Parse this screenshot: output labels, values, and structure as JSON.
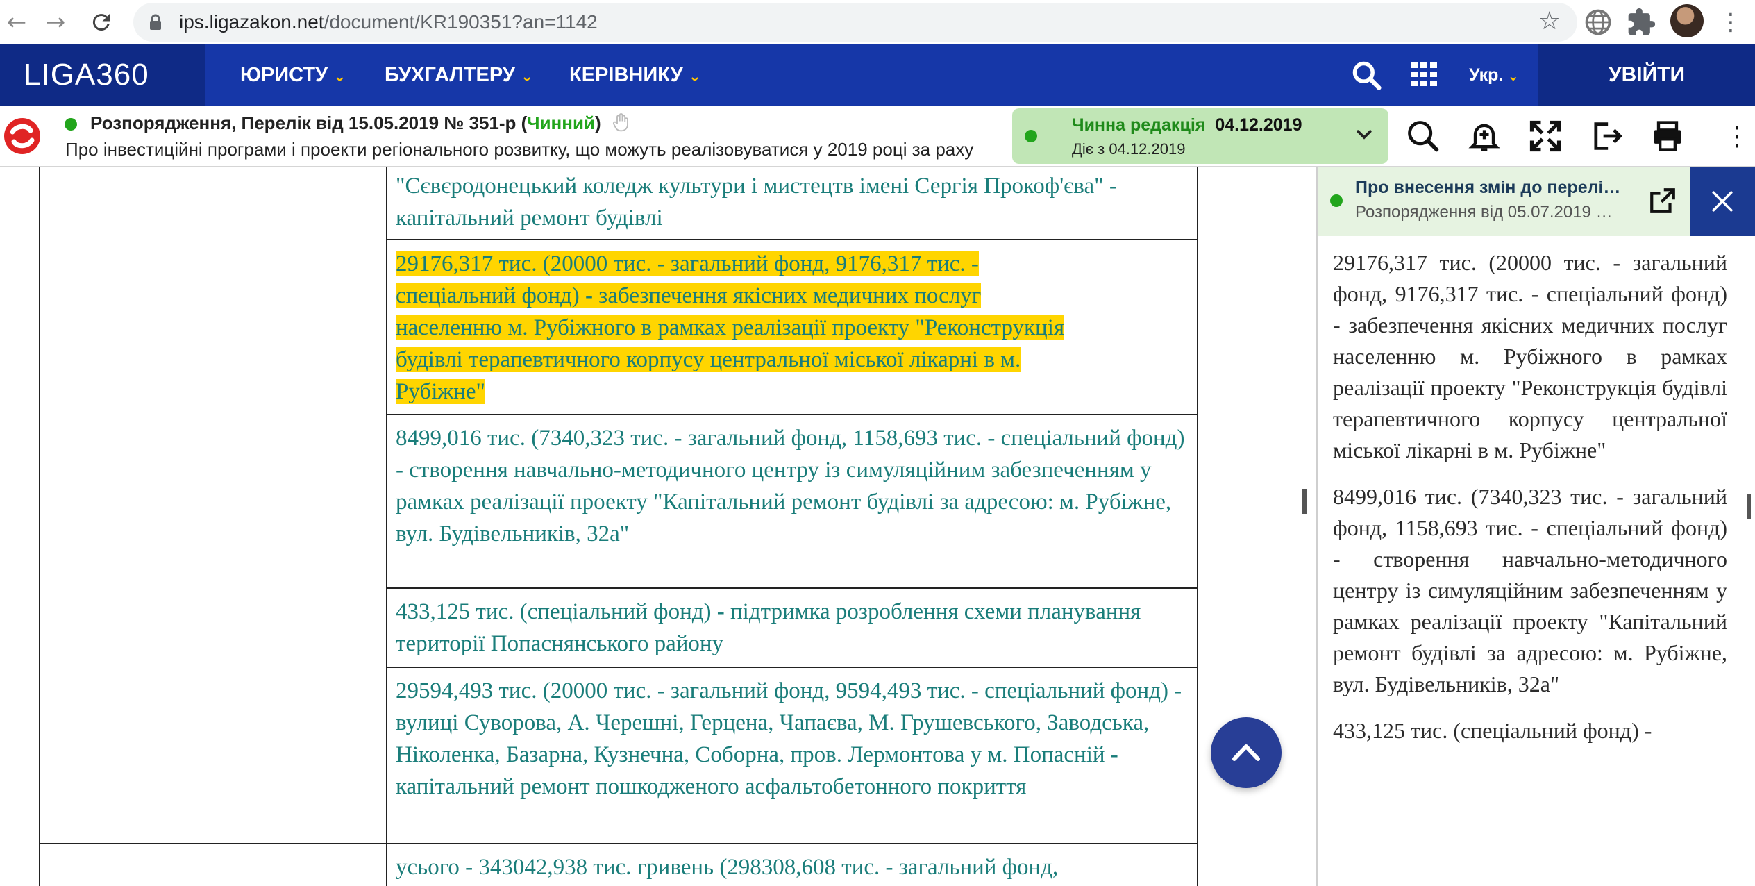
{
  "browser": {
    "url_host": "ips.ligazakon.net",
    "url_path": "/document/KR190351?an=1142"
  },
  "header": {
    "logo": "LIGA360",
    "menu": [
      {
        "label": "ЮРИСТУ"
      },
      {
        "label": "БУХГАЛТЕРУ"
      },
      {
        "label": "КЕРІВНИКУ"
      }
    ],
    "lang": "Укр.",
    "login": "УВІЙТИ"
  },
  "doc": {
    "title": "Розпорядження, Перелік від 15.05.2019 № 351-р (",
    "status": "Чинний",
    "title_end": ")",
    "subtitle": "Про інвестиційні програми і проекти регіонального розвитку, що можуть реалізовуватися у 2019 році за раху…",
    "edition_label": "Чинна редакція",
    "edition_date": "04.12.2019",
    "edition_since": "Діє з 04.12.2019"
  },
  "content": {
    "cells": [
      "\"Сєвєродонецький коледж культури і мистецтв імені Сергія Прокоф'єва\" - капітальний ремонт будівлі",
      "29176,317 тис. (20000 тис. - загальний фонд, 9176,317 тис. - спеціальний фонд) - забезпечення якісних медичних послуг населенню м. Рубіжного в рамках реалізації проекту \"Реконструкція будівлі терапевтичного корпусу центральної міської лікарні в м. Рубіжне\"",
      "8499,016 тис. (7340,323 тис. - загальний фонд, 1158,693 тис. - спеціальний фонд) - створення навчально-методичного центру із симуляційним забезпеченням у рамках реалізації проекту \"Капітальний ремонт будівлі за адресою: м. Рубіжне, вул. Будівельників, 32а\"",
      "433,125 тис. (спеціальний фонд) - підтримка розроблення схеми планування території Попаснянського району",
      "29594,493 тис. (20000 тис. - загальний фонд, 9594,493 тис. - спеціальний фонд) - вулиці Суворова, А. Черешні, Герцена, Чапаєва, М. Грушевського, Заводська, Ніколенка, Базарна, Кузнечна, Соборна, пров. Лермонтова у м. Попасній - капітальний ремонт пошкодженого асфальтобетонного покриття",
      "усього - 343042,938 тис. гривень (298308,608 тис. - загальний фонд,"
    ],
    "highlight_lines": [
      "29176,317 тис. (20000 тис. - загальний фонд, 9176,317 тис. -",
      "спеціальний фонд) - забезпечення якісних медичних послуг",
      "населенню м. Рубіжного в рамках реалізації проекту \"Реконструкція",
      "будівлі терапевтичного корпусу центральної міської лікарні в м.",
      "Рубіжне\""
    ]
  },
  "panel": {
    "title": "Про внесення змін до перелі…",
    "subtitle": "Розпорядження від 05.07.2019 …",
    "paragraphs": [
      "29176,317 тис. (20000 тис. - загальний фонд, 9176,317 тис. - спеціальний фонд) - забезпечення якісних медичних послуг населенню м. Рубіжного в рамках реалізації проекту \"Реконструкція будівлі терапевтичного корпусу центральної міської лікарні в м. Рубіжне\"",
      "8499,016 тис. (7340,323 тис. - загальний фонд, 1158,693 тис. - спеціальний фонд) - створення навчально-методичного центру із симуляційним забезпеченням у рамках реалізації проекту \"Капітальний ремонт будівлі за адресою: м. Рубіжне, вул. Будівельників, 32а\"",
      "433,125 тис. (спеціальний фонд) -"
    ]
  },
  "colors": {
    "brand_blue": "#1637a8",
    "dark_blue": "#0f2a86",
    "accent_yellow": "#ffc400",
    "status_green": "#22a51c",
    "link_teal": "#1a7d7a",
    "highlight": "#ffd500"
  },
  "icons": [
    "back-icon",
    "forward-icon",
    "reload-icon",
    "lock-icon",
    "star-icon",
    "globe-icon",
    "puzzle-icon",
    "search-icon",
    "apps-grid-icon",
    "bell-icon",
    "expand-icon",
    "export-icon",
    "print-icon",
    "more-icon",
    "external-link-icon",
    "close-icon",
    "arrow-up-icon"
  ]
}
